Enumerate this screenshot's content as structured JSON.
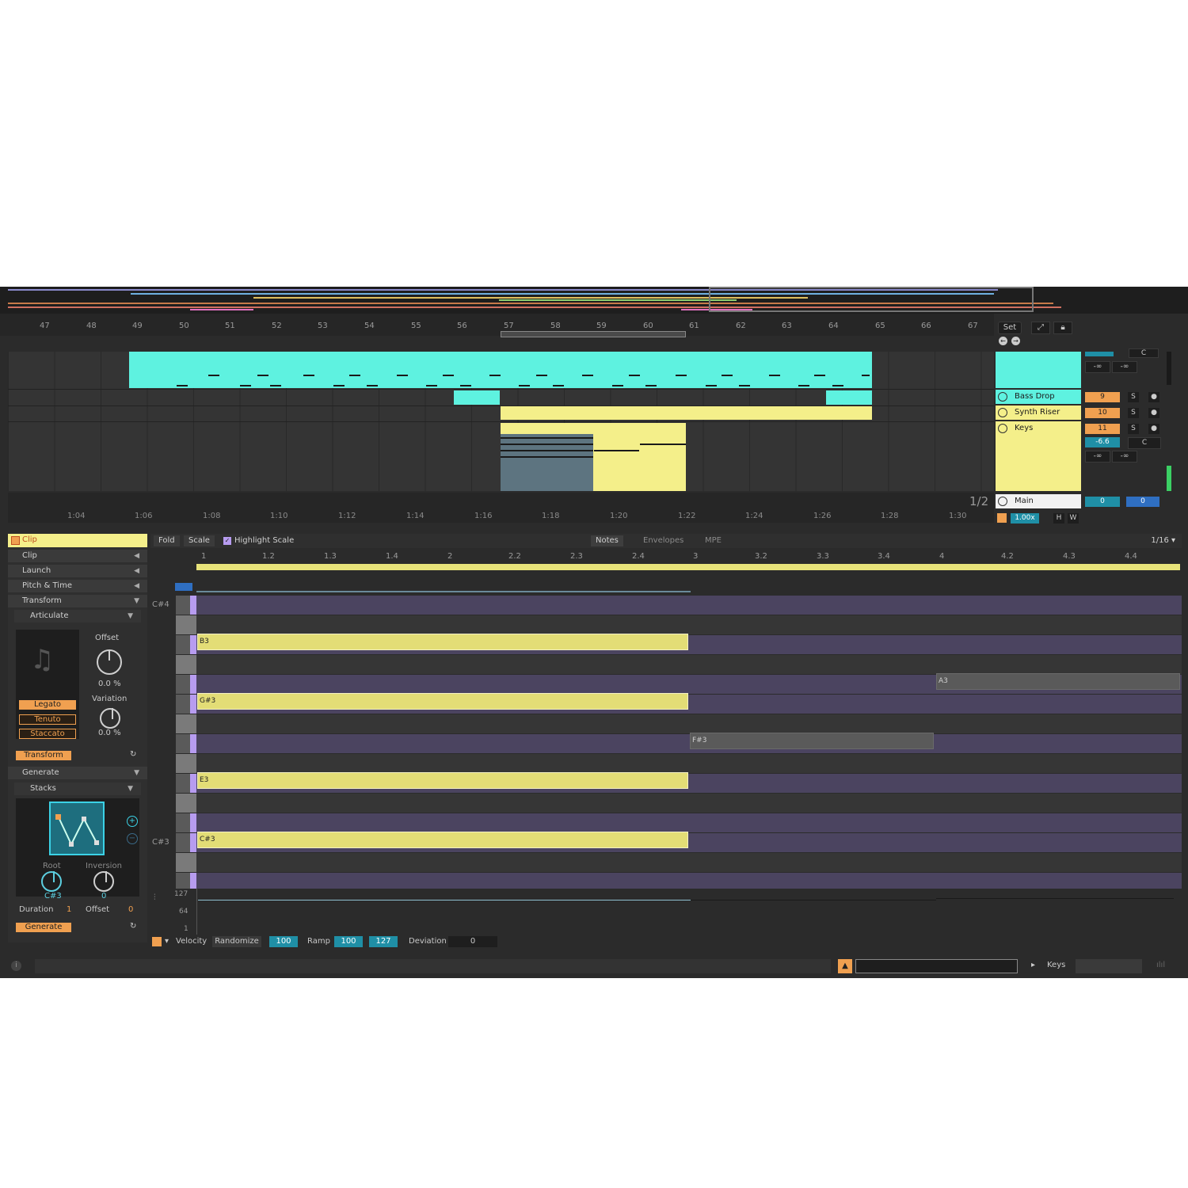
{
  "colors": {
    "cyan": "#5ef2e0",
    "yellow": "#f4ef8a",
    "yellow_note": "#e3dd76",
    "purple_row": "#4b4460",
    "purple_key": "#b79cf0",
    "orange": "#f0a050",
    "teal_value": "#1f8fa6",
    "blue_value": "#2f6fc2"
  },
  "arrangement": {
    "bar_numbers": [
      "47",
      "48",
      "49",
      "50",
      "51",
      "52",
      "53",
      "54",
      "55",
      "56",
      "57",
      "58",
      "59",
      "60",
      "61",
      "62",
      "63",
      "64",
      "65",
      "66",
      "67"
    ],
    "time_labels": [
      "1:04",
      "1:06",
      "1:08",
      "1:10",
      "1:12",
      "1:14",
      "1:16",
      "1:18",
      "1:20",
      "1:22",
      "1:24",
      "1:26",
      "1:28",
      "1:30"
    ],
    "page_indicator": "1/2",
    "set_button": "Set"
  },
  "tracks": [
    {
      "name": "Bass Drop",
      "number": "9",
      "solo": "S"
    },
    {
      "name": "Synth Riser",
      "number": "10",
      "solo": "S"
    },
    {
      "name": "Keys",
      "number": "11",
      "solo": "S",
      "volume": "-6.6",
      "pan": "C"
    }
  ],
  "mixer": {
    "neg_inf": "-∞",
    "main_label": "Main",
    "main_values": [
      "0",
      "0"
    ],
    "tempo_scale": "1.00x",
    "h_btn": "H",
    "w_btn": "W",
    "top_pan": "C"
  },
  "left_panel": {
    "clip_title": "Clip",
    "sections": [
      {
        "label": "Clip",
        "arrow": "◀"
      },
      {
        "label": "Launch",
        "arrow": "◀"
      },
      {
        "label": "Pitch & Time",
        "arrow": "◀"
      },
      {
        "label": "Transform",
        "arrow": "▼"
      }
    ],
    "articulate": {
      "device": "Articulate",
      "offset_label": "Offset",
      "offset_value": "0.0 %",
      "variation_label": "Variation",
      "variation_value": "0.0 %",
      "options": [
        "Legato",
        "Tenuto",
        "Staccato"
      ],
      "action": "Transform"
    },
    "generate": {
      "section": "Generate",
      "device": "Stacks",
      "root_label": "Root",
      "root_value": "C#3",
      "inversion_label": "Inversion",
      "inversion_value": "0",
      "duration_label": "Duration",
      "duration_value": "1",
      "offset_label": "Offset",
      "offset_value": "0",
      "action": "Generate"
    }
  },
  "editor": {
    "fold": "Fold",
    "scale": "Scale",
    "highlight_scale": "Highlight Scale",
    "tabs": [
      "Notes",
      "Envelopes",
      "MPE"
    ],
    "grid": "1/16 ▾",
    "beats": [
      "1",
      "1.2",
      "1.3",
      "1.4",
      "2",
      "2.2",
      "2.3",
      "2.4",
      "3",
      "3.2",
      "3.3",
      "3.4",
      "4",
      "4.2",
      "4.3",
      "4.4"
    ],
    "key_labels": {
      "top": "C#4",
      "bottom": "C#3"
    },
    "notes": [
      {
        "label": "B3"
      },
      {
        "label": "G#3"
      },
      {
        "label": "E3"
      },
      {
        "label": "C#3"
      },
      {
        "label": "A3"
      },
      {
        "label": "F#3"
      }
    ],
    "velocity_scale": [
      "127",
      "64",
      "1"
    ]
  },
  "velocity_bar": {
    "velocity": "Velocity",
    "randomize": "Randomize",
    "randomize_value": "100",
    "ramp": "Ramp",
    "ramp_from": "100",
    "ramp_to": "127",
    "deviation": "Deviation",
    "deviation_value": "0"
  },
  "status": {
    "track_name": "Keys"
  }
}
